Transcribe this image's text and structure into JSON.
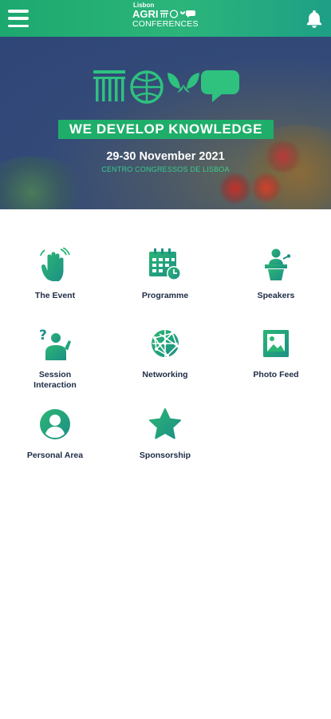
{
  "header": {
    "logo_city": "Lisbon",
    "logo_agri": "AGRI",
    "logo_conf": "CONFERENCES",
    "menu_icon": "hamburger-menu-icon",
    "notification_icon": "bell-icon"
  },
  "hero": {
    "banner": "WE DEVELOP KNOWLEDGE",
    "date": "29-30 November 2021",
    "venue": "CENTRO CONGRESSOS DE LISBOA"
  },
  "tiles": [
    {
      "label": "The Event",
      "icon": "waving-hand-icon"
    },
    {
      "label": "Programme",
      "icon": "calendar-clock-icon"
    },
    {
      "label": "Speakers",
      "icon": "speaker-podium-icon"
    },
    {
      "label": "Session\nInteraction",
      "icon": "question-person-icon"
    },
    {
      "label": "Networking",
      "icon": "network-globe-icon"
    },
    {
      "label": "Photo Feed",
      "icon": "photo-icon"
    },
    {
      "label": "Personal Area",
      "icon": "user-avatar-icon"
    },
    {
      "label": "Sponsorship",
      "icon": "star-icon"
    }
  ],
  "colors": {
    "brand_green": "#1fae6a",
    "icon_gradient_start": "#2bb673",
    "icon_gradient_end": "#1c8f86",
    "hero_blue": "#2e4577",
    "label_text": "#1d2b45"
  }
}
